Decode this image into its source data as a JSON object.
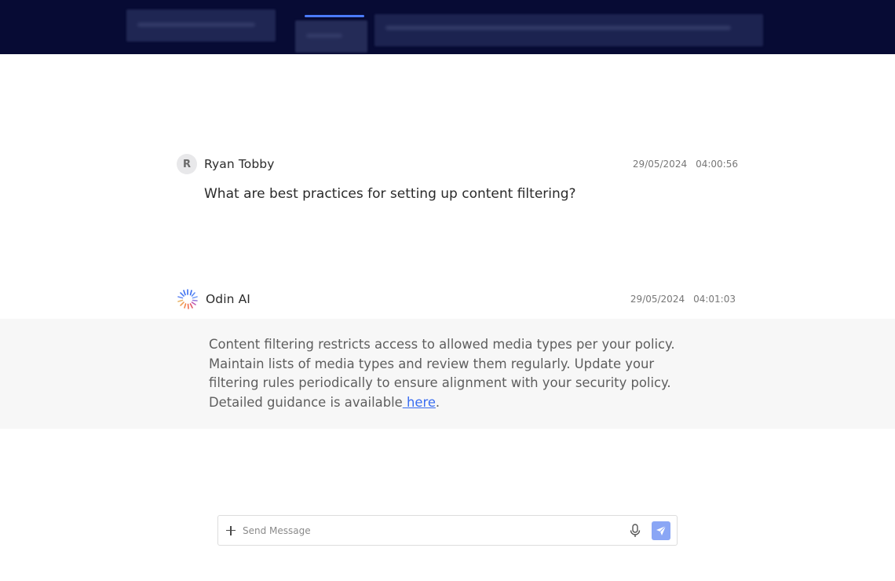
{
  "messages": [
    {
      "sender": "Ryan Tobby",
      "avatar_letter": "R",
      "date": "29/05/2024",
      "time": "04:00:56",
      "text": "What are best practices for setting up content filtering?"
    },
    {
      "sender": "Odin AI",
      "date": "29/05/2024",
      "time": "04:01:03",
      "text_line_1": "Content filtering restricts access to allowed media types per your policy.",
      "text_line_2": "Maintain lists of media types and review them regularly. Update your",
      "text_line_3": "filtering rules periodically to ensure alignment with your security policy.",
      "text_line_4": "Detailed guidance is available",
      "link_text": " here",
      "trailing": "."
    }
  ],
  "composer": {
    "placeholder": "Send Message"
  },
  "colors": {
    "nav_background": "#070b34",
    "accent": "#4b7bff",
    "link": "#3a6df0",
    "send_button": "#8aa6f5"
  }
}
